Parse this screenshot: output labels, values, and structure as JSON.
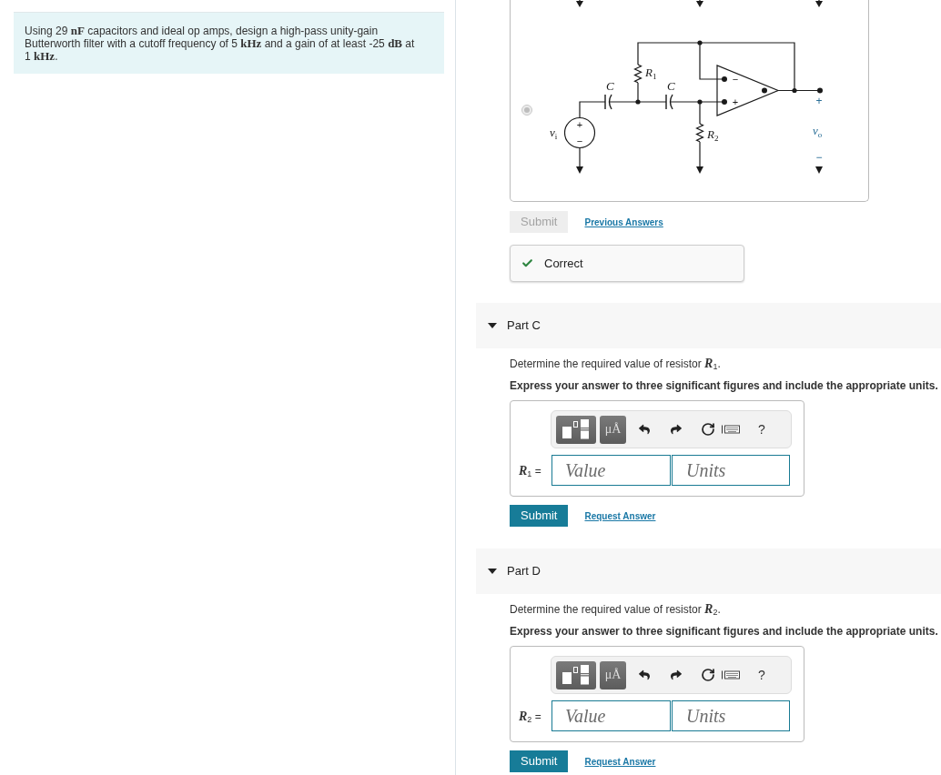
{
  "problem": {
    "text": "Using 29 **nF** capacitors and ideal op amps, design a high-pass unity-gain Butterworth filter with a cutoff frequency of 5 **kHz** and a gain of at least -25 **dB** at 1 **kHz**."
  },
  "part_b": {
    "choice": {
      "selected": true,
      "disabled": true
    },
    "circuit": {
      "source": {
        "symbol": "v",
        "sub": "i",
        "plus": "+",
        "minus": "−"
      },
      "capacitors": [
        {
          "label": "C"
        },
        {
          "label": "C"
        }
      ],
      "resistors": [
        {
          "symbol": "R",
          "sub": "1"
        },
        {
          "symbol": "R",
          "sub": "2"
        }
      ],
      "op_amp": {
        "minus": "−",
        "plus": "+"
      },
      "output": {
        "symbol": "v",
        "sub": "o",
        "plus": "+",
        "minus": "−"
      }
    },
    "submit": {
      "label": "Submit",
      "disabled": true
    },
    "link": "Previous Answers",
    "feedback": {
      "kind": "correct",
      "text": "Correct"
    }
  },
  "parts": [
    {
      "title": "Part C",
      "expanded": true,
      "prompt": "Determine the required value of resistor **R**$_{1}$.",
      "instruction": "Express your answer to three significant figures and include the appropriate units.",
      "toolbar": {
        "units_button": "μÅ",
        "help": "?"
      },
      "answer": {
        "label": "**R**$_{1}$ =",
        "value_placeholder": "Value",
        "units_placeholder": "Units"
      },
      "submit": {
        "label": "Submit",
        "disabled": false
      },
      "link": "Request Answer"
    },
    {
      "title": "Part D",
      "expanded": true,
      "prompt": "Determine the required value of resistor **R**$_{2}$.",
      "instruction": "Express your answer to three significant figures and include the appropriate units.",
      "toolbar": {
        "units_button": "μÅ",
        "help": "?"
      },
      "answer": {
        "label": "**R**$_{2}$ =",
        "value_placeholder": "Value",
        "units_placeholder": "Units"
      },
      "submit": {
        "label": "Submit",
        "disabled": false
      },
      "link": "Request Answer"
    }
  ]
}
